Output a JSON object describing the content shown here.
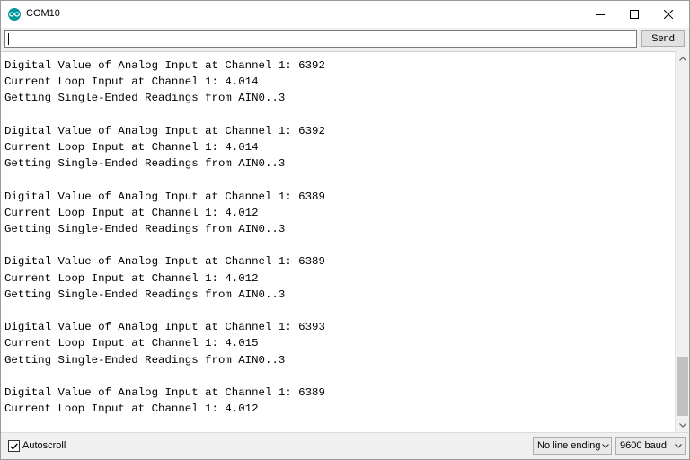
{
  "window": {
    "title": "COM10",
    "app_icon": "arduino-icon"
  },
  "sendbar": {
    "input_value": "",
    "send_label": "Send"
  },
  "output": {
    "lines": [
      "Digital Value of Analog Input at Channel 1: 6392",
      "Current Loop Input at Channel 1: 4.014",
      "Getting Single-Ended Readings from AIN0..3",
      "",
      "Digital Value of Analog Input at Channel 1: 6392",
      "Current Loop Input at Channel 1: 4.014",
      "Getting Single-Ended Readings from AIN0..3",
      "",
      "Digital Value of Analog Input at Channel 1: 6389",
      "Current Loop Input at Channel 1: 4.012",
      "Getting Single-Ended Readings from AIN0..3",
      "",
      "Digital Value of Analog Input at Channel 1: 6389",
      "Current Loop Input at Channel 1: 4.012",
      "Getting Single-Ended Readings from AIN0..3",
      "",
      "Digital Value of Analog Input at Channel 1: 6393",
      "Current Loop Input at Channel 1: 4.015",
      "Getting Single-Ended Readings from AIN0..3",
      "",
      "Digital Value of Analog Input at Channel 1: 6389",
      "Current Loop Input at Channel 1: 4.012"
    ]
  },
  "statusbar": {
    "autoscroll_label": "Autoscroll",
    "autoscroll_checked": true,
    "line_ending": "No line ending",
    "baud_rate": "9600 baud"
  },
  "colors": {
    "accent": "#00979c",
    "scrollbar_thumb": "#c1c1c1"
  }
}
